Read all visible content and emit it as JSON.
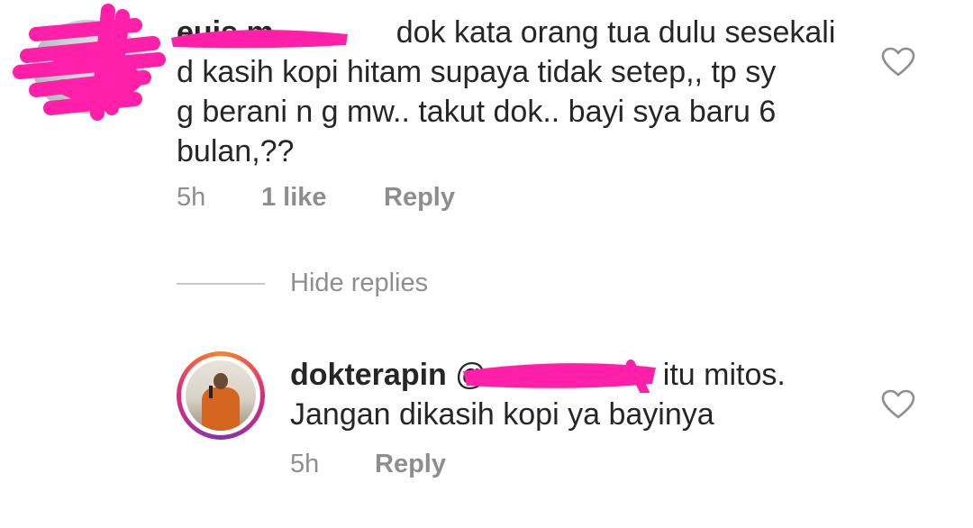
{
  "comment": {
    "username_visible": "euis m",
    "text_line1": "dok kata orang tua dulu sesekali",
    "text_line2": "d kasih kopi hitam supaya tidak setep,, tp sy",
    "text_line3": "g berani n g mw.. takut dok.. bayi sya baru 6",
    "text_line4": "bulan,??",
    "time": "5h",
    "likes": "1 like",
    "reply_label": "Reply"
  },
  "hide_replies_label": "Hide replies",
  "reply": {
    "username": "dokterapin",
    "mention_visible": "@",
    "text_line1_tail": "itu mitos.",
    "text_line2": "Jangan dikasih kopi ya bayinya",
    "time": "5h",
    "reply_label": "Reply"
  },
  "colors": {
    "redaction": "#ff1fa8",
    "meta_text": "#8e8e8e",
    "heart_stroke": "#8e8e8e"
  },
  "icons": {
    "like": "heart-outline-icon"
  }
}
